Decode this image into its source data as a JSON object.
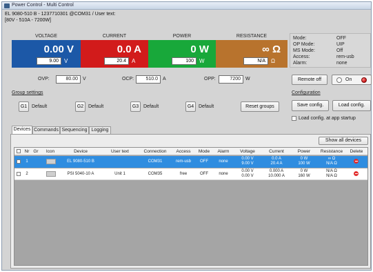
{
  "window": {
    "title": "Power Control - Multi Control"
  },
  "device_info": {
    "line1": "EL 9080-510 B - 1237710301 @COM31 / User text:",
    "line2": "[80V - 510A - 7200W]"
  },
  "measurements": {
    "voltage": {
      "header": "VOLTAGE",
      "actual": "0.00 V",
      "set": "9.00",
      "unit": "V",
      "color": "#1c58a7"
    },
    "current": {
      "header": "CURRENT",
      "actual": "0.0 A",
      "set": "20.4",
      "unit": "A",
      "color": "#d21b1b"
    },
    "power": {
      "header": "POWER",
      "actual": "0 W",
      "set": "100",
      "unit": "W",
      "color": "#18a83a"
    },
    "resistance": {
      "header": "RESISTANCE",
      "actual": "∞ Ω",
      "set": "N/A",
      "unit": "Ω",
      "color": "#b8732d"
    }
  },
  "status": [
    {
      "label": "Mode:",
      "value": "OFF"
    },
    {
      "label": "OP Mode:",
      "value": "UIP"
    },
    {
      "label": "MS Mode:",
      "value": "Off"
    },
    {
      "label": "Access:",
      "value": "rem-usb"
    },
    {
      "label": "Alarm:",
      "value": "none"
    }
  ],
  "protection": {
    "ovp": {
      "label": "OVP:",
      "value": "80.00",
      "unit": "V"
    },
    "ocp": {
      "label": "OCP:",
      "value": "510.0",
      "unit": "A"
    },
    "opp": {
      "label": "OPP:",
      "value": "7200",
      "unit": "W"
    }
  },
  "remote_off_label": "Remote off",
  "onoff": {
    "on_label": "On"
  },
  "group_settings": {
    "title": "Group settings",
    "groups": [
      {
        "button": "G1",
        "label": "Default"
      },
      {
        "button": "G2",
        "label": "Default"
      },
      {
        "button": "G3",
        "label": "Default"
      },
      {
        "button": "G4",
        "label": "Default"
      }
    ],
    "reset_label": "Reset groups"
  },
  "configuration": {
    "title": "Configuration",
    "save_label": "Save config.",
    "load_label": "Load config.",
    "load_startup_label": "Load config. at app startup"
  },
  "tabs": [
    "Devices",
    "Commands",
    "Sequencing",
    "Logging"
  ],
  "show_all_label": "Show all devices",
  "table": {
    "headers": [
      "Nr",
      "Gr",
      "Icon",
      "Device",
      "User text",
      "Connection",
      "Access",
      "Mode",
      "Alarm",
      "Voltage",
      "Current",
      "Power",
      "Resistance",
      "Delete"
    ],
    "rows": [
      {
        "nr": "1",
        "gr": "",
        "device": "EL 9080-510 B",
        "user_text": "",
        "connection": "COM31",
        "access": "rem-usb",
        "mode": "OFF",
        "alarm": "none",
        "voltage_a": "0.00 V",
        "voltage_b": "9.00 V",
        "current_a": "0.0 A",
        "current_b": "20.4 A",
        "power_a": "0 W",
        "power_b": "100 W",
        "res_a": "∞ Ω",
        "res_b": "N/A Ω"
      },
      {
        "nr": "2",
        "gr": "",
        "device": "PSI 5040-10 A",
        "user_text": "Unit 1",
        "connection": "COM35",
        "access": "free",
        "mode": "OFF",
        "alarm": "none",
        "voltage_a": "0.00 V",
        "voltage_b": "0.00 V",
        "current_a": "0.000 A",
        "current_b": "10.000 A",
        "power_a": "0 W",
        "power_b": "160 W",
        "res_a": "N/A Ω",
        "res_b": "N/A Ω"
      }
    ]
  }
}
